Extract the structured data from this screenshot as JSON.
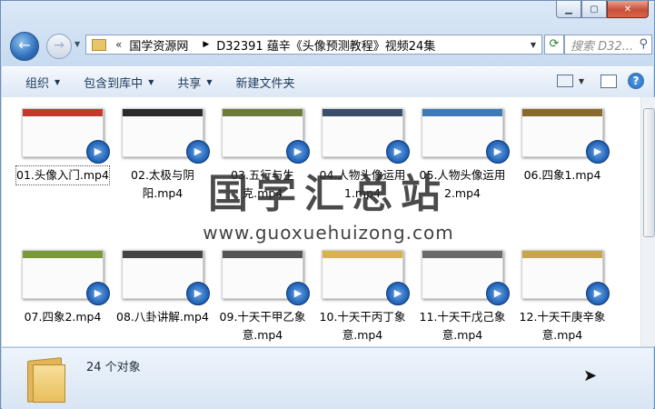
{
  "window": {
    "caption_buttons": [
      "minimize-icon",
      "maximize-icon",
      "close-icon"
    ]
  },
  "nav": {
    "address": {
      "prefix": "«",
      "segments": [
        "国学资源网",
        "D32391 蕴辛《头像预测教程》视频24集"
      ]
    },
    "search_placeholder": "搜索 D32..."
  },
  "toolbar": {
    "organize": "组织",
    "include_library": "包含到库中",
    "share": "共享",
    "new_folder": "新建文件夹"
  },
  "files": [
    {
      "name": "01.头像入门.mp4",
      "band": "#c23a2a",
      "selected": true
    },
    {
      "name": "02.太极与阴阳.mp4",
      "band": "#2b2b2b"
    },
    {
      "name": "03.五行与生克.mp4",
      "band": "#6b7c3a"
    },
    {
      "name": "04.人物头像运用1.mp4",
      "band": "#3a4d6b"
    },
    {
      "name": "05.人物头像运用2.mp4",
      "band": "#3c7ab8"
    },
    {
      "name": "06.四象1.mp4",
      "band": "#8a6a2a"
    },
    {
      "name": "07.四象2.mp4",
      "band": "#7a9a3a"
    },
    {
      "name": "08.八卦讲解.mp4",
      "band": "#444444"
    },
    {
      "name": "09.十天干甲乙象意.mp4",
      "band": "#555555"
    },
    {
      "name": "10.十天干丙丁象意.mp4",
      "band": "#d8b34a"
    },
    {
      "name": "11.十天干戊己象意.mp4",
      "band": "#6a6a6a"
    },
    {
      "name": "12.十天干庚辛象意.mp4",
      "band": "#c9a54a"
    }
  ],
  "watermark": {
    "title": "国学汇总站",
    "url": "www.guoxuehuizong.com"
  },
  "details": {
    "count": "24 个对象"
  }
}
